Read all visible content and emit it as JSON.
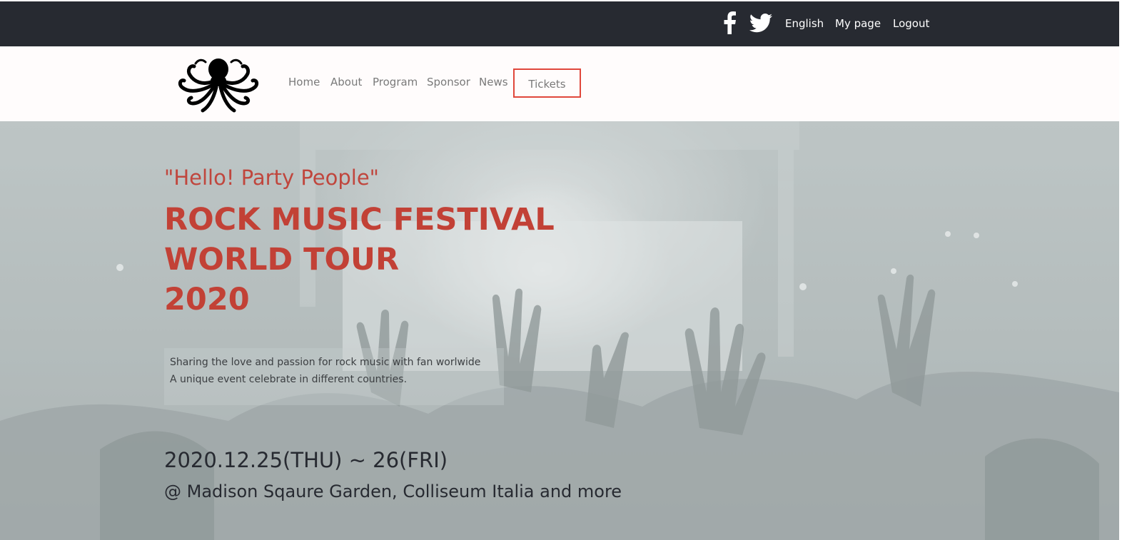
{
  "topbar": {
    "social": [
      {
        "icon": "facebook-icon"
      },
      {
        "icon": "twitter-icon"
      }
    ],
    "links": {
      "language": "English",
      "my_page": "My page",
      "logout": "Logout"
    }
  },
  "nav": {
    "logo_icon": "octopus-logo",
    "items": [
      "Home",
      "About",
      "Program",
      "Sponsor",
      "News"
    ],
    "tickets": "Tickets"
  },
  "hero": {
    "tagline": "\"Hello! Party People\"",
    "headline": [
      "ROCK MUSIC FESTIVAL",
      "WORLD TOUR",
      "2020"
    ],
    "description": [
      "Sharing the love and passion for rock music with fan worlwide",
      "A unique event celebrate in different countries."
    ],
    "date": "2020.12.25(THU) ~ 26(FRI)",
    "venue": "@ Madison Sqaure Garden, Colliseum Italia and more"
  },
  "colors": {
    "topbar_bg": "#272a31",
    "accent_red": "#c24136",
    "tickets_border": "#e0473b",
    "nav_text": "#7a7a7a"
  }
}
